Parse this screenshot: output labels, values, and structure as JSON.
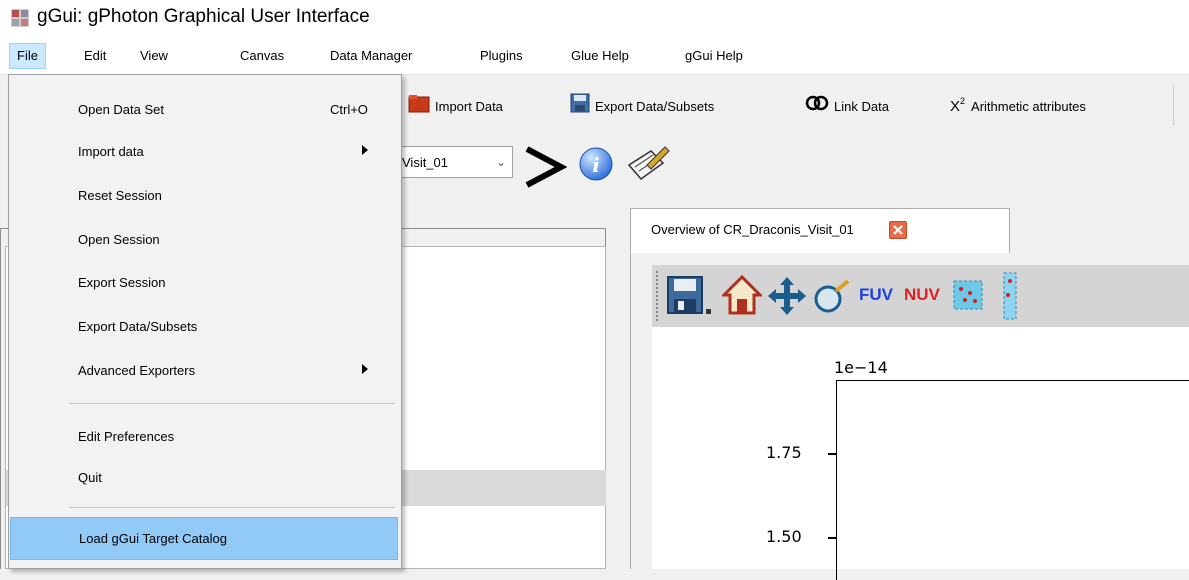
{
  "window": {
    "title": "gGui: gPhoton Graphical User Interface"
  },
  "menubar": {
    "items": [
      {
        "label": "File"
      },
      {
        "label": "Edit"
      },
      {
        "label": "View"
      },
      {
        "label": "Canvas"
      },
      {
        "label": "Data Manager"
      },
      {
        "label": "Plugins"
      },
      {
        "label": "Glue Help"
      },
      {
        "label": "gGui Help"
      }
    ]
  },
  "file_menu": {
    "items": [
      {
        "label": "Open Data Set",
        "shortcut": "Ctrl+O"
      },
      {
        "label": "Import data",
        "submenu": true
      },
      {
        "label": "Reset Session"
      },
      {
        "label": "Open Session"
      },
      {
        "label": "Export Session"
      },
      {
        "label": "Export Data/Subsets"
      },
      {
        "label": "Advanced Exporters",
        "submenu": true
      },
      {
        "label": "Edit Preferences"
      },
      {
        "label": "Quit"
      },
      {
        "label": "Load gGui Target Catalog",
        "highlighted": true
      }
    ]
  },
  "toolbar": {
    "import_label": "Import Data",
    "export_label": "Export Data/Subsets",
    "link_label": "Link Data",
    "arithmetic_label": "Arithmetic attributes",
    "arithmetic_symbol": "X",
    "arithmetic_exp": "2"
  },
  "subset_bar": {
    "selected_value": "Visit_01"
  },
  "tab": {
    "label": "Overview of CR_Draconis_Visit_01"
  },
  "viewer_toolbar": {
    "fuv_label": "FUV",
    "nuv_label": "NUV",
    "fuv_color": "#1f3fe0",
    "nuv_color": "#e02020"
  },
  "plot": {
    "offset_label": "1e−14",
    "y_ticks": [
      "1.75",
      "1.50"
    ]
  },
  "colors": {
    "menu_highlight": "#91c9f7",
    "active_menu": "#cce8ff"
  }
}
